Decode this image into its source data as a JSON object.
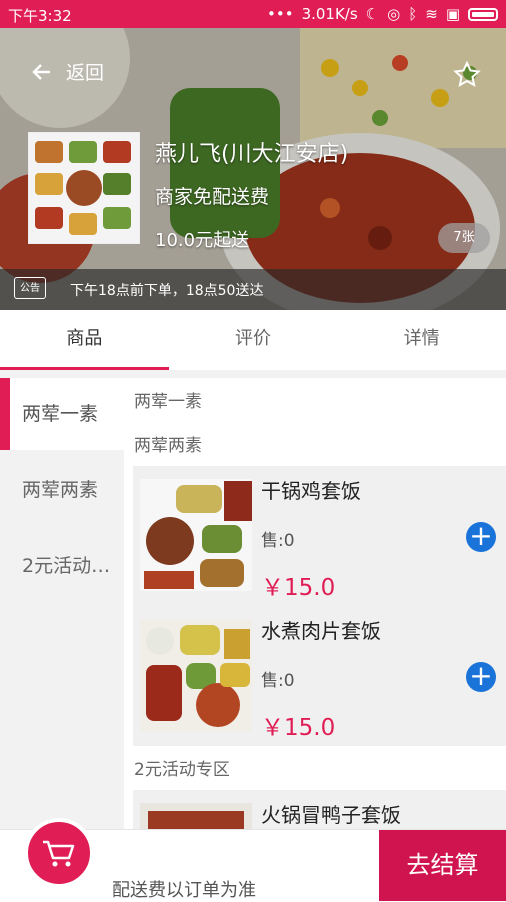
{
  "status_bar": {
    "time": "下午3:32",
    "network_speed": "3.01K/s",
    "icons": [
      "more-dots-icon",
      "moon-icon",
      "alarm-icon",
      "bluetooth-icon",
      "wifi-icon",
      "sim-icon",
      "battery-icon"
    ]
  },
  "header": {
    "back_label": "返回",
    "shop_name": "燕儿飞(川大江安店)",
    "delivery_fee": "商家免配送费",
    "min_order": "10.0元起送",
    "photo_count": "7张",
    "notice_tag": "公告",
    "notice_text": "下午18点前下单，18点50送达"
  },
  "tabs": [
    {
      "label": "商品",
      "active": true
    },
    {
      "label": "评价",
      "active": false
    },
    {
      "label": "详情",
      "active": false
    }
  ],
  "categories": [
    {
      "label": "两荤一素",
      "active": true
    },
    {
      "label": "两荤两素",
      "active": false
    },
    {
      "label": "2元活动…",
      "active": false
    }
  ],
  "sections": [
    {
      "title": "两荤一素",
      "items": []
    },
    {
      "title": "两荤两素",
      "items": [
        {
          "name": "干锅鸡套饭",
          "sold": "售:0",
          "price": "￥15.0"
        },
        {
          "name": "水煮肉片套饭",
          "sold": "售:0",
          "price": "￥15.0"
        }
      ]
    },
    {
      "title": "2元活动专区",
      "items": [
        {
          "name": "火锅冒鸭子套饭",
          "sold": "",
          "price": ""
        }
      ]
    }
  ],
  "bottom": {
    "fee_tip": "配送费以订单为准",
    "checkout_label": "去结算"
  },
  "colors": {
    "accent": "#e01e55",
    "add_button": "#1a73d9"
  }
}
